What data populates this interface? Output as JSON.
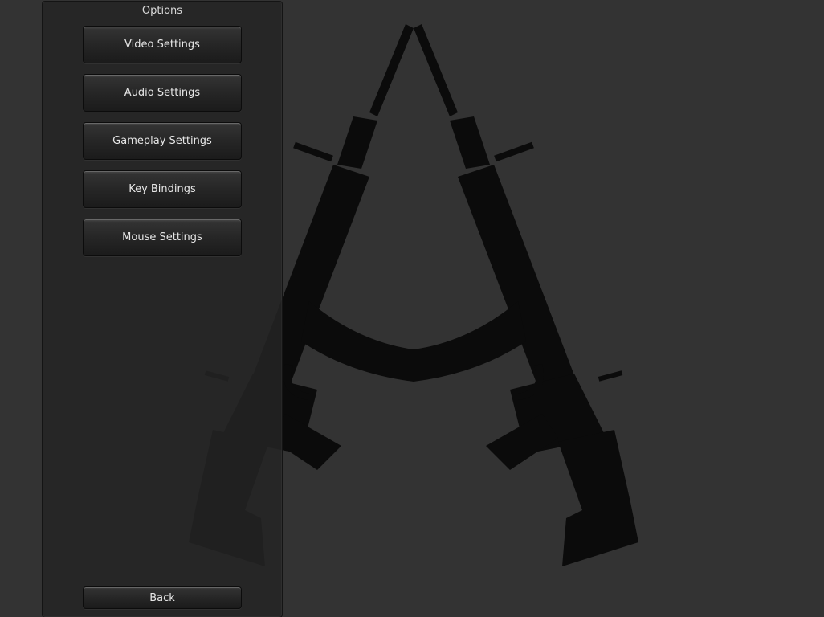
{
  "panel": {
    "title": "Options"
  },
  "menu": {
    "items": [
      {
        "label": "Video Settings"
      },
      {
        "label": "Audio Settings"
      },
      {
        "label": "Gameplay Settings"
      },
      {
        "label": "Key Bindings"
      },
      {
        "label": "Mouse Settings"
      }
    ],
    "back_label": "Back"
  },
  "background": {
    "logo_icon": "crossed-rifles-logo-icon",
    "logo_color": "#0b0b0b"
  }
}
